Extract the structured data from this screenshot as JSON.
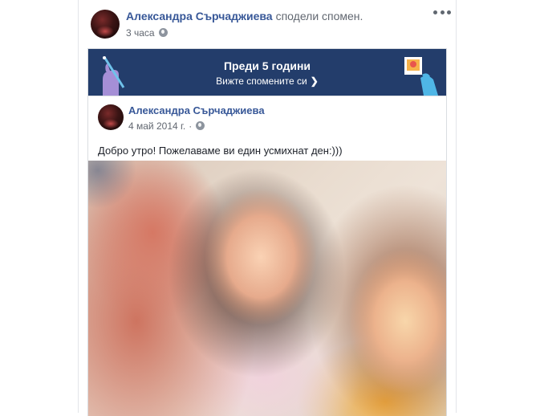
{
  "post": {
    "author": "Александра Сърчаджиева",
    "action": "сподели спомен.",
    "time": "3 часа"
  },
  "memory_banner": {
    "title": "Преди 5 години",
    "link": "Вижте спомените си"
  },
  "inner_post": {
    "author": "Александра Сърчаджиева",
    "date": "4 май 2014 г.",
    "separator": "·",
    "text": "Добро утро! Пожелаваме ви един усмихнат ден:)))"
  },
  "icons": {
    "more": "more-options-icon",
    "privacy": "globe-icon",
    "chevron": "chevron-right-icon"
  },
  "colors": {
    "banner": "#233d6b",
    "link": "#385898",
    "meta": "#616770"
  }
}
